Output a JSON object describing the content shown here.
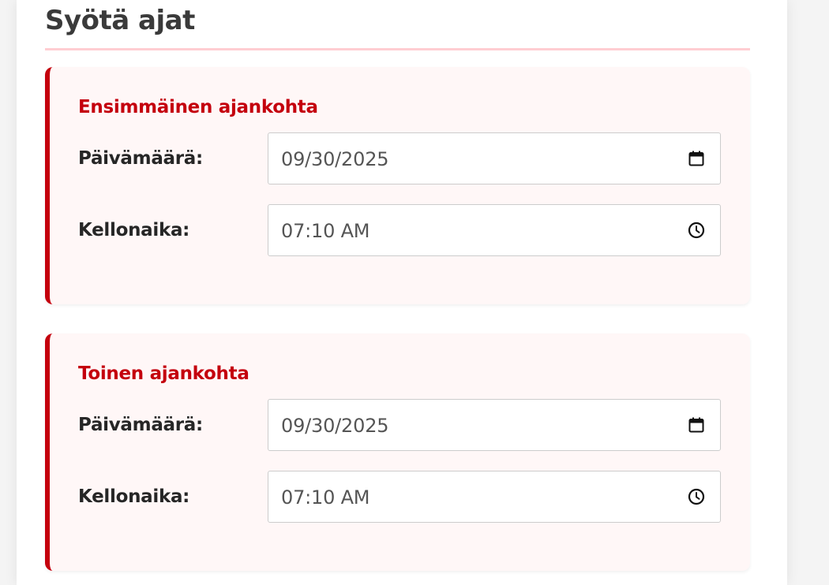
{
  "section": {
    "title": "Syötä ajat"
  },
  "colors": {
    "accent": "#c4000d",
    "card_background": "#fff7f7",
    "title_rule": "#ffcdd2"
  },
  "cards": [
    {
      "title": "Ensimmäinen ajankohta",
      "date_label": "Päivämäärä:",
      "date_value": "09/30/2025",
      "date_icon": "calendar-icon",
      "time_label": "Kellonaika:",
      "time_value": "07:10 AM",
      "time_icon": "clock-icon"
    },
    {
      "title": "Toinen ajankohta",
      "date_label": "Päivämäärä:",
      "date_value": "09/30/2025",
      "date_icon": "calendar-icon",
      "time_label": "Kellonaika:",
      "time_value": "07:10 AM",
      "time_icon": "clock-icon"
    }
  ]
}
